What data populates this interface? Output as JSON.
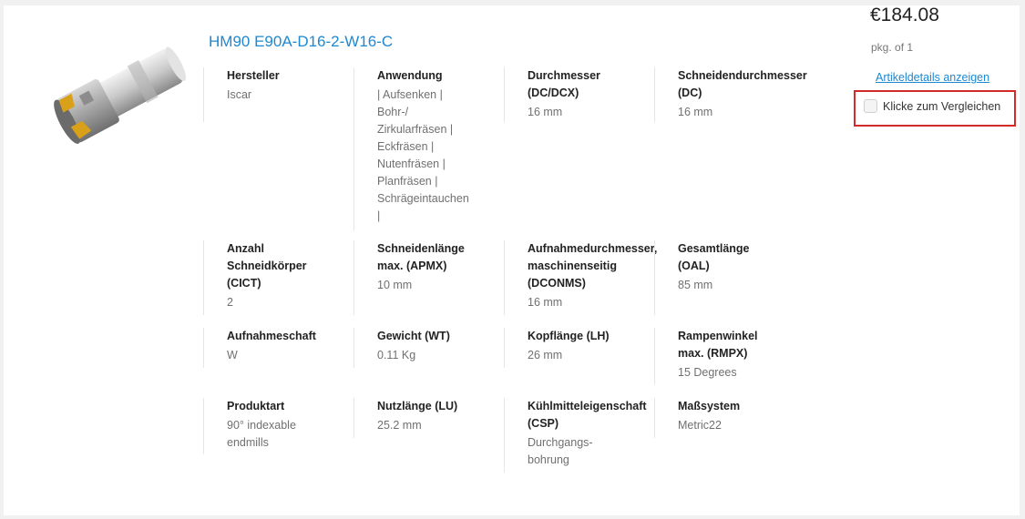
{
  "product": {
    "title": "HM90 E90A-D16-2-W16-C",
    "image_icon": "indexable-endmill-image"
  },
  "pricing": {
    "price": "€184.08",
    "pkg": "pkg. of 1",
    "details_link": "Artikeldetails anzeigen",
    "compare_label": "Klicke zum Vergleichen",
    "compare_checked": false
  },
  "specs": {
    "row1": [
      {
        "label": "Hersteller",
        "value": "Iscar"
      },
      {
        "label": "Anwendung",
        "value": "| Aufsenken |\nBohr-/\nZirkularfräsen |\nEckfräsen |\nNutenfräsen |\nPlanfräsen |\nSchrägeintauchen\n|"
      },
      {
        "label": "Durchmesser\n(DC/DCX)",
        "value": "16 mm"
      },
      {
        "label": "Schneidendurchmesser\n(DC)",
        "value": "16 mm"
      }
    ],
    "row2": [
      {
        "label": "Anzahl\nSchneidkörper\n(CICT)",
        "value": "2"
      },
      {
        "label": "Schneidenlänge\nmax. (APMX)",
        "value": "10 mm"
      },
      {
        "label": "Aufnahmedurchmesser,\nmaschinenseitig\n(DCONMS)",
        "value": "16 mm"
      },
      {
        "label": "Gesamtlänge\n(OAL)",
        "value": "85 mm"
      }
    ],
    "row3": [
      {
        "label": "Aufnahmeschaft",
        "value": "W"
      },
      {
        "label": "Gewicht (WT)",
        "value": "0.11 Kg"
      },
      {
        "label": "Kopflänge (LH)",
        "value": "26 mm"
      },
      {
        "label": "Rampenwinkel\nmax. (RMPX)",
        "value": "15 Degrees"
      }
    ],
    "row4": [
      {
        "label": "Produktart",
        "value": "90° indexable\nendmills"
      },
      {
        "label": "Nutzlänge (LU)",
        "value": "25.2 mm"
      },
      {
        "label": "Kühlmitteleigenschaft\n(CSP)",
        "value": "Durchgangs-\nbohrung"
      },
      {
        "label": "Maßsystem",
        "value": "Metric22"
      }
    ]
  }
}
